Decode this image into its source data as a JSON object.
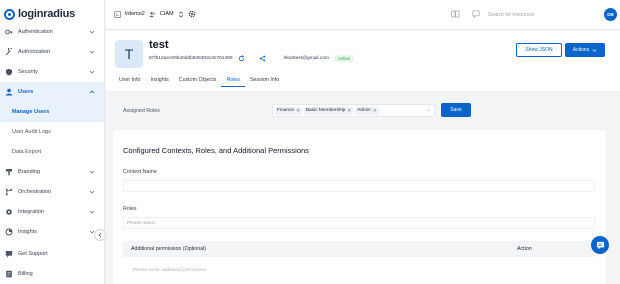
{
  "brand": {
    "logo_text": "loginradius",
    "accent": "#0b64c9"
  },
  "sidebar": {
    "items": [
      {
        "label": "Authentication",
        "icon": "key-icon"
      },
      {
        "label": "Authorization",
        "icon": "wrench-icon"
      },
      {
        "label": "Security",
        "icon": "shield-icon"
      },
      {
        "label": "Users",
        "icon": "user-icon"
      }
    ],
    "users_sub": [
      {
        "label": "Manage Users"
      },
      {
        "label": "User Audit Logs"
      },
      {
        "label": "Data Export"
      }
    ],
    "items2": [
      {
        "label": "Branding",
        "icon": "brush-icon"
      },
      {
        "label": "Orchestration",
        "icon": "flow-icon"
      },
      {
        "label": "Integration",
        "icon": "puzzle-icon"
      },
      {
        "label": "Insights",
        "icon": "insights-icon"
      },
      {
        "label": "Get Support",
        "icon": "support-icon"
      },
      {
        "label": "Billing",
        "icon": "billing-icon"
      }
    ]
  },
  "topbar": {
    "tenant_badge": "L",
    "tenant_name": "lrdemo2",
    "app_type": "CIAM",
    "search_placeholder": "Search for resources",
    "avatar_initials": "DB"
  },
  "profile": {
    "avatar_letter": "T",
    "name": "test",
    "uid": "87f912aec09b40ddb936363c3e701499",
    "email": "lrkwittest@gmail.com",
    "status": "Active",
    "show_json": "Show JSON",
    "actions": "Actions"
  },
  "tabs": [
    "User Info",
    "Insights",
    "Custom Objects",
    "Roles",
    "Session Info"
  ],
  "assigned": {
    "label": "Assigned Roles",
    "chips": [
      "Finance",
      "Basic Membership",
      "Admin"
    ],
    "save": "Save"
  },
  "panel": {
    "title": "Configured Contexts, Roles, and Additional Permissions",
    "context_label": "Context Name",
    "roles_label": "Roles",
    "roles_placeholder": "Please select",
    "col1": "Additional permission (Optional)",
    "col2": "Action",
    "permission_placeholder": "Please enter additional permission"
  }
}
